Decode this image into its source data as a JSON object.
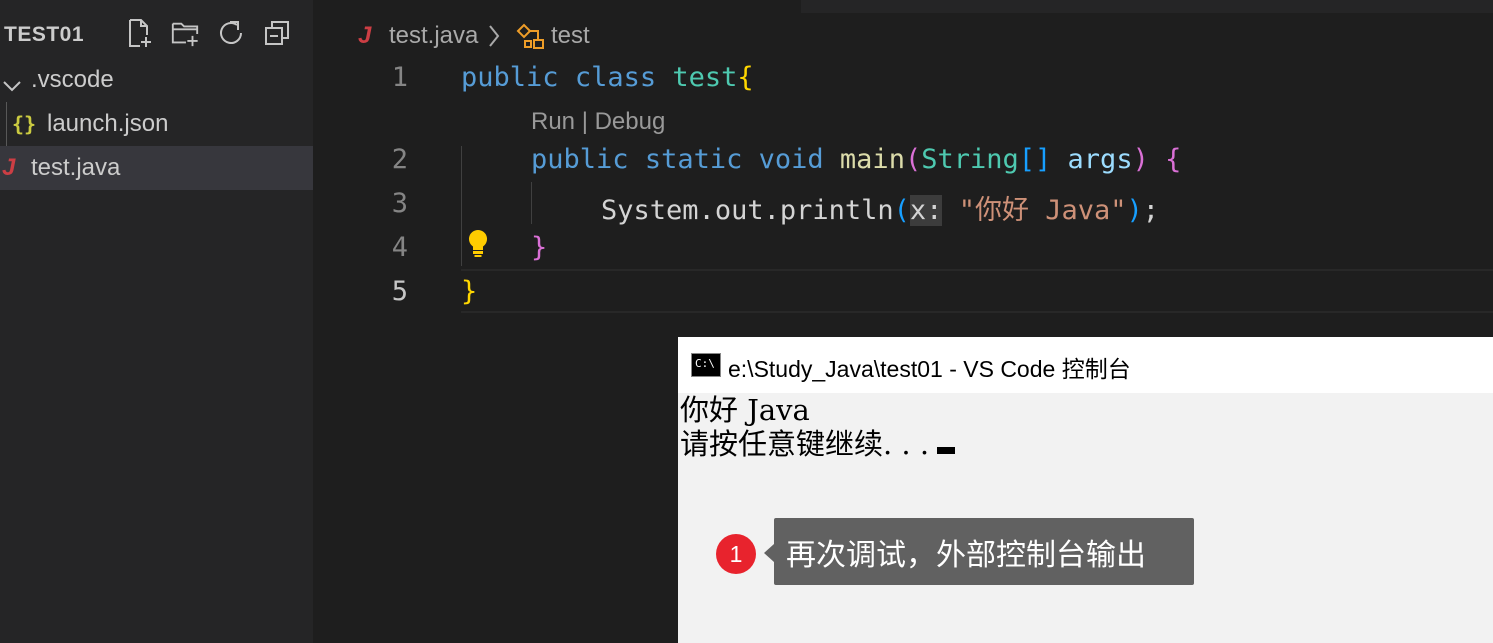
{
  "explorer": {
    "title": "TEST01",
    "actions": [
      "new-file-icon",
      "new-folder-icon",
      "refresh-icon",
      "collapse-all-icon"
    ],
    "folder": ".vscode",
    "files": [
      {
        "icon": "{}",
        "name": "launch.json"
      },
      {
        "icon": "J",
        "name": "test.java"
      }
    ]
  },
  "breadcrumb": {
    "icon": "J",
    "file": "test.java",
    "symbol": "test"
  },
  "editor": {
    "line_numbers": [
      "1",
      "2",
      "3",
      "4",
      "5"
    ],
    "codelens": "Run | Debug",
    "line1": {
      "kw1": "public",
      "kw2": "class",
      "name": "test",
      "brace": "{"
    },
    "line2": {
      "kw1": "public",
      "kw2": "static",
      "kw3": "void",
      "fn": "main",
      "open": "(",
      "type": "String",
      "arr": "[]",
      "param": "args",
      "close": ")",
      "brace": "{"
    },
    "line3": {
      "obj": "System",
      "dot1": ".",
      "field": "out",
      "dot2": ".",
      "fn": "println",
      "open": "(",
      "hint": "x:",
      "str": "\"你好 Java\"",
      "close": ")",
      "semi": ";"
    },
    "line4": {
      "brace": "}"
    },
    "line5": {
      "brace": "}"
    }
  },
  "console": {
    "title": "e:\\Study_Java\\test01 - VS Code 控制台",
    "icon_text": "C:\\",
    "lines": [
      "你好 Java",
      "请按任意键继续. . ."
    ]
  },
  "callout": {
    "number": "1",
    "text": "再次调试，外部控制台输出"
  },
  "colors": {
    "accent_badge": "#e8232d",
    "java_icon": "#cc3e44",
    "json_icon": "#cbcb41",
    "keyword": "#569cd6",
    "class": "#4ec9b0",
    "string": "#ce9178"
  }
}
